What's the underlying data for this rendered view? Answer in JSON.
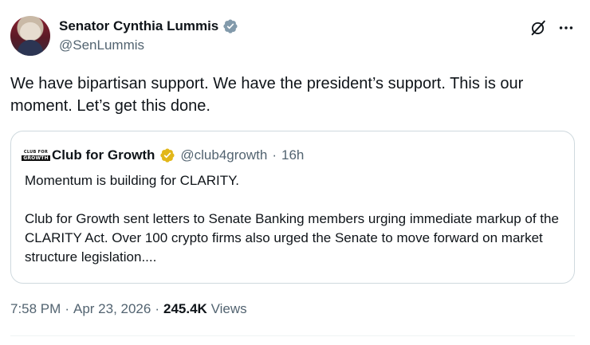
{
  "author": {
    "display_name": "Senator Cynthia Lummis",
    "handle": "@SenLummis",
    "verified_badge_color": "#829aab",
    "avatar_icon": "profile-photo"
  },
  "tweet": {
    "text": "We have bipartisan support. We have the president’s support. This is our moment. Let’s get this done."
  },
  "quote": {
    "author_name": "Club for Growth",
    "logo_text_top": "CLUB FOR",
    "logo_text_bottom": "GROWTH",
    "verified_badge_color": "#e2b719",
    "handle": "@club4growth",
    "separator": "·",
    "time": "16h",
    "paragraph_1": "Momentum is building for CLARITY.",
    "paragraph_2": "Club for Growth sent letters to Senate Banking members urging immediate markup of the CLARITY Act. Over 100 crypto firms also urged the Senate to move forward on market structure legislation...."
  },
  "footer": {
    "time": "7:58 PM",
    "separator": "·",
    "date": "Apr 23, 2026",
    "views_count": "245.4K",
    "views_label": "Views"
  },
  "icons": {
    "grok": "grok-icon",
    "more": "more-icon"
  },
  "colors": {
    "text": "#0f1419",
    "secondary": "#536471",
    "border": "#cfd9de"
  }
}
